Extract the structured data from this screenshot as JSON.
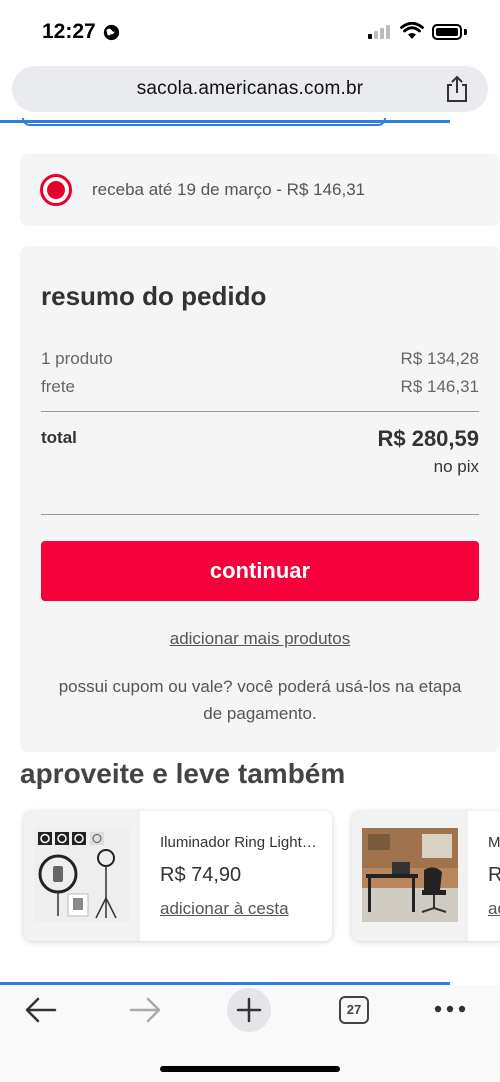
{
  "status_bar": {
    "time": "12:27"
  },
  "browser": {
    "url": "sacola.americanas.com.br",
    "tab_count": "27"
  },
  "delivery": {
    "option_label": "receba até 19 de março - R$ 146,31",
    "selected": true,
    "accent_color": "#e8002c"
  },
  "summary": {
    "title": "resumo do pedido",
    "products_label": "1 produto",
    "products_value": "R$ 134,28",
    "shipping_label": "frete",
    "shipping_value": "R$ 146,31",
    "total_label": "total",
    "total_value": "R$ 280,59",
    "total_note": "no pix",
    "continue_label": "continuar",
    "continue_color": "#f5003a",
    "add_more_label": "adicionar mais produtos",
    "coupon_text_line1": "possui cupom ou vale? você poderá usá-los na etapa",
    "coupon_text_line2": "de pagamento."
  },
  "recommendations": {
    "title": "aproveite e leve também",
    "items": [
      {
        "name": "Iluminador Ring Light…",
        "price": "R$ 74,90",
        "add_label": "adicionar à cesta"
      },
      {
        "name": "M",
        "price": "R",
        "add_label": "ad"
      }
    ]
  },
  "toolbar": {
    "icons": [
      "back-arrow-icon",
      "forward-arrow-icon",
      "new-tab-plus-icon",
      "tabs-count-icon",
      "more-options-icon"
    ]
  }
}
